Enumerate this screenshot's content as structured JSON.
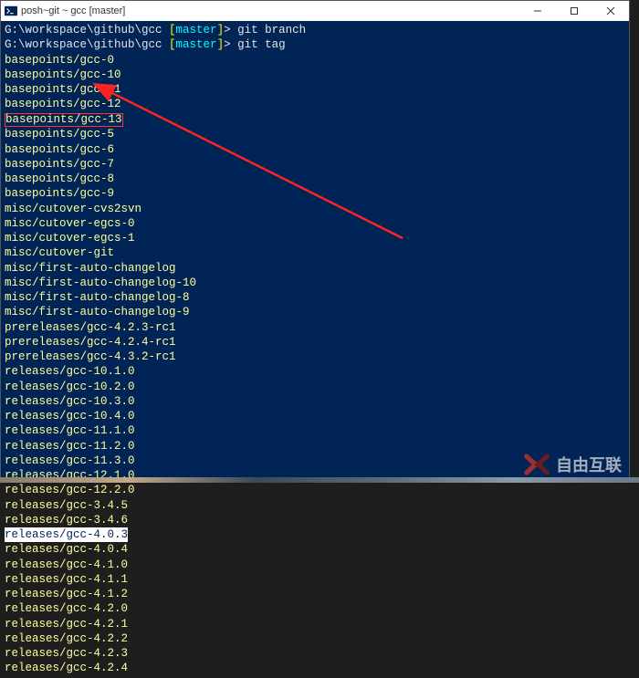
{
  "window": {
    "title": "posh~git ~ gcc [master]"
  },
  "prompts": [
    {
      "path": "G:\\workspace\\github\\gcc ",
      "branch": "master",
      "cmd": " git branch"
    },
    {
      "path": "G:\\workspace\\github\\gcc ",
      "branch": "master",
      "cmd": " git tag"
    }
  ],
  "tags": [
    {
      "text": "basepoints/gcc-0",
      "hl": null
    },
    {
      "text": "basepoints/gcc-10",
      "hl": null
    },
    {
      "text": "basepoints/gcc-11",
      "hl": null
    },
    {
      "text": "basepoints/gcc-12",
      "hl": null
    },
    {
      "text": "basepoints/gcc-13",
      "hl": "red"
    },
    {
      "text": "basepoints/gcc-5",
      "hl": null
    },
    {
      "text": "basepoints/gcc-6",
      "hl": null
    },
    {
      "text": "basepoints/gcc-7",
      "hl": null
    },
    {
      "text": "basepoints/gcc-8",
      "hl": null
    },
    {
      "text": "basepoints/gcc-9",
      "hl": null
    },
    {
      "text": "misc/cutover-cvs2svn",
      "hl": null
    },
    {
      "text": "misc/cutover-egcs-0",
      "hl": null
    },
    {
      "text": "misc/cutover-egcs-1",
      "hl": null
    },
    {
      "text": "misc/cutover-git",
      "hl": null
    },
    {
      "text": "misc/first-auto-changelog",
      "hl": null
    },
    {
      "text": "misc/first-auto-changelog-10",
      "hl": null
    },
    {
      "text": "misc/first-auto-changelog-8",
      "hl": null
    },
    {
      "text": "misc/first-auto-changelog-9",
      "hl": null
    },
    {
      "text": "prereleases/gcc-4.2.3-rc1",
      "hl": null
    },
    {
      "text": "prereleases/gcc-4.2.4-rc1",
      "hl": null
    },
    {
      "text": "prereleases/gcc-4.3.2-rc1",
      "hl": null
    },
    {
      "text": "releases/gcc-10.1.0",
      "hl": null
    },
    {
      "text": "releases/gcc-10.2.0",
      "hl": null
    },
    {
      "text": "releases/gcc-10.3.0",
      "hl": null
    },
    {
      "text": "releases/gcc-10.4.0",
      "hl": null
    },
    {
      "text": "releases/gcc-11.1.0",
      "hl": null
    },
    {
      "text": "releases/gcc-11.2.0",
      "hl": null
    },
    {
      "text": "releases/gcc-11.3.0",
      "hl": null
    },
    {
      "text": "releases/gcc-12.1.0",
      "hl": null
    },
    {
      "text": "releases/gcc-12.2.0",
      "hl": null
    },
    {
      "text": "releases/gcc-3.4.5",
      "hl": null
    },
    {
      "text": "releases/gcc-3.4.6",
      "hl": null
    },
    {
      "text": "releases/gcc-4.0.3",
      "hl": "cursor"
    },
    {
      "text": "releases/gcc-4.0.4",
      "hl": null
    },
    {
      "text": "releases/gcc-4.1.0",
      "hl": null
    },
    {
      "text": "releases/gcc-4.1.1",
      "hl": null
    },
    {
      "text": "releases/gcc-4.1.2",
      "hl": null
    },
    {
      "text": "releases/gcc-4.2.0",
      "hl": null
    },
    {
      "text": "releases/gcc-4.2.1",
      "hl": null
    },
    {
      "text": "releases/gcc-4.2.2",
      "hl": null
    },
    {
      "text": "releases/gcc-4.2.3",
      "hl": null
    },
    {
      "text": "releases/gcc-4.2.4",
      "hl": null
    }
  ],
  "watermark": "自由互联"
}
